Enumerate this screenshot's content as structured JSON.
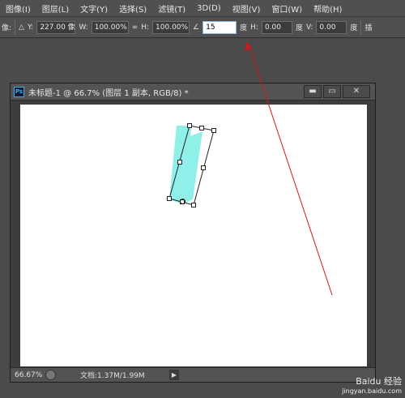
{
  "menu": [
    "图像(I)",
    "图层(L)",
    "文字(Y)",
    "选择(S)",
    "滤镜(T)",
    "3D(D)",
    "视图(V)",
    "窗口(W)",
    "帮助(H)"
  ],
  "options": {
    "left_cut": "像:",
    "delta_icon": "△",
    "y_label": "Y:",
    "y_value": "227.00 像",
    "w_label": "W:",
    "w_value": "100.00%",
    "link_icon": "∞",
    "h_label": "H:",
    "h_value": "100.00%",
    "angle_icon": "∠",
    "angle_value": "15",
    "degree": "度",
    "hskew_label": "H:",
    "hskew_value": "0.00",
    "hskew_unit": "度",
    "vskew_label": "V:",
    "vskew_value": "0.00",
    "vskew_unit": "度",
    "right_cut": "插"
  },
  "document": {
    "icon": "Ps",
    "title": "未标题-1 @ 66.7% (图层 1 副本, RGB/8) *",
    "minimize": "▬",
    "maximize": "▭",
    "close": "✕"
  },
  "status": {
    "zoom": "66.67%",
    "doc_info": "文档:1.37M/1.99M",
    "arrow": "▶"
  },
  "watermark": {
    "line1": "Baidu 经验",
    "line2": "jingyan.baidu.com"
  },
  "colors": {
    "shape": "#8ff0ea",
    "arrow": "#cc1a1a"
  }
}
